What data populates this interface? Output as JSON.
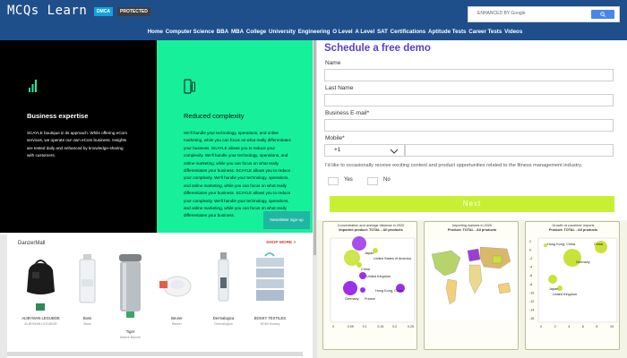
{
  "header": {
    "logo": "MCQs Learn",
    "badge_dmca": "DMCA",
    "badge_protected": "PROTECTED",
    "search_placeholder": "ENHANCED BY Google",
    "nav": [
      "Home",
      "Computer Science",
      "BBA",
      "MBA",
      "College",
      "University",
      "Engineering",
      "O Level",
      "A Level",
      "SAT",
      "Certifications",
      "Aptitude Tests",
      "Career Tests",
      "Videos"
    ]
  },
  "panels": {
    "business": {
      "title": "Business expertise",
      "body": "SCAYLE boutique in its approach. While offering eCom services, we operate our own eCom business. Insights are tested daily and enhanced by knowledge-sharing with customers."
    },
    "complexity": {
      "title": "Reduced complexity",
      "body": "We'll handle your technology, operations, and online marketing, while you can focus on what really differentiates your business. SCAYLE allows you to reduce your complexity. We'll handle your technology, operations, and online marketing, while you can focus on what really differentiates your business. SCAYLE allows you to reduce your complexity. We'll handle your technology, operations, and online marketing, while you can focus on what really differentiates your business. SCAYLE allows you to reduce your complexity. We'll handle your technology, operations, and online marketing, while you can focus on what really differentiates your business.",
      "signup": "Newsletter sign-up"
    }
  },
  "products": {
    "title": "DanzerMall",
    "more": "SHOP MORE >",
    "items": [
      {
        "name": "ALIBYMAN LEGUBOE",
        "sub": "ALIBYMAN LEGUBOE"
      },
      {
        "name": "Boss",
        "sub": "Boss"
      },
      {
        "name": "Tiger",
        "sub": "Maeve Bonnie"
      },
      {
        "name": "Beurer",
        "sub": "Beurer"
      },
      {
        "name": "Dermalogica",
        "sub": "Dermalogica"
      },
      {
        "name": "BOSKY TEXTILES",
        "sub": "HDMI Ksosby"
      }
    ]
  },
  "form": {
    "title": "Schedule a free demo",
    "name_label": "Name",
    "lastname_label": "Last Name",
    "email_label": "Business E-mail*",
    "mobile_label": "Mobile*",
    "country_code": "+1",
    "consent": "I'd like to occasionally receive exciting content and product opportunities related to the fitness management industry.",
    "yes_label": "Yes",
    "no_label": "No",
    "next_label": "Next"
  },
  "chart_data": [
    {
      "type": "scatter",
      "title": "Concentration and average distance in 2020",
      "subtitle": "Imported product: TOTAL - All products",
      "series": [
        {
          "labels": [
            "Japan",
            "United States of America",
            "China",
            "United Kingdom",
            "Germany",
            "France",
            "Hong Kong, China"
          ]
        }
      ],
      "xticks": [
        "0",
        "0.05",
        "0.1",
        "0.15",
        "0.2",
        "0.25"
      ],
      "yticks": []
    },
    {
      "type": "map",
      "title": "Importing markets in 2020",
      "subtitle": "Product: TOTAL - All products"
    },
    {
      "type": "scatter",
      "title": "Growth of countries' imports",
      "subtitle": "Product: TOTAL - All products",
      "series": [
        {
          "labels": [
            "Hong Kong, China",
            "China",
            "Germany",
            "Japan",
            "United Kingdom"
          ]
        }
      ],
      "xticks": [
        "0",
        "2",
        "4",
        "6",
        "8",
        "10"
      ],
      "yticks": [
        "2",
        "0",
        "-2",
        "-4",
        "-6",
        "-8",
        "-10",
        "-12",
        "-14",
        "-16"
      ]
    }
  ],
  "colors": {
    "header": "#1f4f8b",
    "green_panel": "#17f09a",
    "form_title": "#5b3ec9",
    "next_button": "#c8f032"
  }
}
